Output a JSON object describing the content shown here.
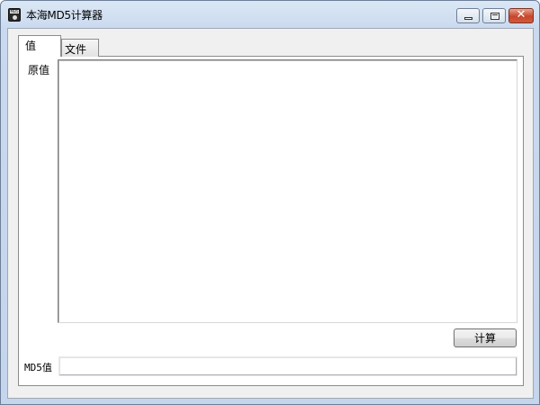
{
  "window": {
    "title": "本海MD5计算器",
    "icon": "md5-app-icon",
    "icon_text": "MD5",
    "buttons": {
      "minimize": "minimize-icon",
      "maximize": "maximize-icon",
      "close": "close-icon",
      "close_glyph": "✕"
    }
  },
  "tabs": [
    {
      "label": "值",
      "active": true
    },
    {
      "label": "文件",
      "active": false
    }
  ],
  "value_tab": {
    "original_label": "原值",
    "original_value": "",
    "calc_button": "计算",
    "md5_label": "MD5值",
    "md5_value": ""
  }
}
